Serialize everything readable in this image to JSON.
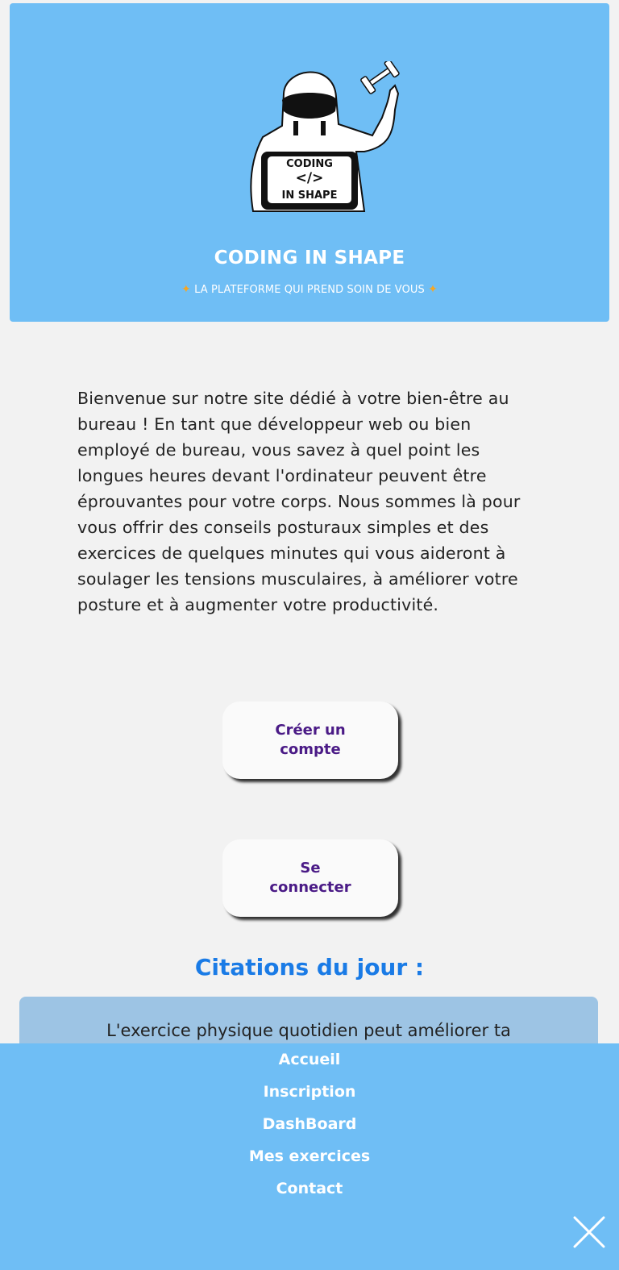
{
  "hero": {
    "logo_text": [
      "CODING",
      "</>",
      "IN SHAPE"
    ],
    "title": "CODING IN SHAPE",
    "subtitle": "LA PLATEFORME QUI PREND SOIN DE VOUS",
    "accent_color": "#6fbef5"
  },
  "intro": {
    "text": "Bienvenue sur notre site dédié à votre bien-être au bureau ! En tant que développeur web ou bien employé de bureau, vous savez à quel point les longues heures devant l'ordinateur peuvent être éprouvantes pour votre corps. Nous sommes là pour vous offrir des conseils posturaux simples et des exercices de quelques minutes qui vous aideront à soulager les tensions musculaires, à améliorer votre posture et à augmenter votre productivité."
  },
  "actions": {
    "signup_label": "Créer un compte",
    "login_label": "Se connecter"
  },
  "quotes": {
    "title": "Citations du jour :",
    "current": "L'exercice physique quotidien peut améliorer ta"
  },
  "menu": {
    "items": [
      {
        "label": "Accueil"
      },
      {
        "label": "Inscription"
      },
      {
        "label": "DashBoard"
      },
      {
        "label": "Mes exercices"
      },
      {
        "label": "Contact"
      }
    ],
    "close_icon": "close-icon"
  }
}
